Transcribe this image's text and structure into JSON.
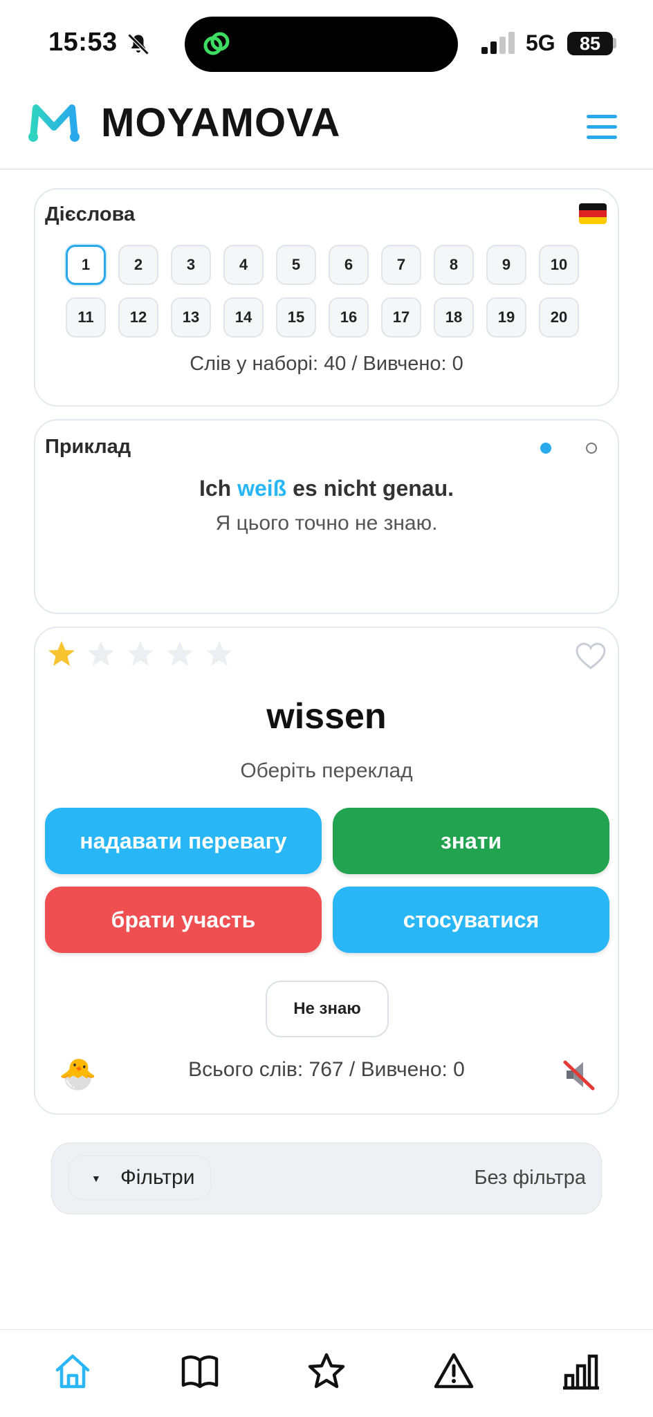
{
  "status_bar": {
    "time": "15:53",
    "network": "5G",
    "battery": "85"
  },
  "header": {
    "app_name": "MOYAMOVA"
  },
  "set_card": {
    "title": "Дієслова",
    "sets": [
      "1",
      "2",
      "3",
      "4",
      "5",
      "6",
      "7",
      "8",
      "9",
      "10",
      "11",
      "12",
      "13",
      "14",
      "15",
      "16",
      "17",
      "18",
      "19",
      "20"
    ],
    "active_set": "1",
    "stats": "Слів у наборі: 40 / Вивчено: 0"
  },
  "example_card": {
    "title": "Приклад",
    "sentence_before": "Ich ",
    "sentence_highlight": "weiß",
    "sentence_after": " es nicht genau.",
    "translation": "Я цього точно не знаю."
  },
  "quiz": {
    "rating": 1,
    "rating_max": 5,
    "word": "wissen",
    "hint": "Оберіть переклад",
    "answers": [
      {
        "label": "надавати перевагу",
        "color": "#29b6f6"
      },
      {
        "label": "знати",
        "color": "#22a34f"
      },
      {
        "label": "брати участь",
        "color": "#ef4f50"
      },
      {
        "label": "стосуватися",
        "color": "#29b6f6"
      }
    ],
    "dont_know": "Не знаю",
    "total_stats": "Всього слів: 767 / Вивчено: 0"
  },
  "filters": {
    "label": "Фільтри",
    "value": "Без фільтра"
  },
  "colors": {
    "accent": "#29a8ec",
    "star": "#f7c32e",
    "correct": "#22a34f",
    "wrong": "#ef4f50"
  },
  "bottom_nav": [
    "home-icon",
    "book-icon",
    "star-icon",
    "warning-icon",
    "stats-icon"
  ]
}
